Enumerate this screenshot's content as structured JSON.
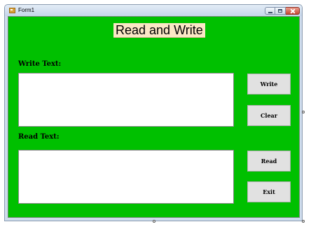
{
  "window": {
    "title": "Form1"
  },
  "form": {
    "heading": "Read and Write",
    "write_label": "Write Text:",
    "read_label": "Read Text:",
    "write_text_value": "",
    "read_text_value": ""
  },
  "buttons": {
    "write": "Write",
    "clear": "Clear",
    "read": "Read",
    "exit": "Exit"
  },
  "colors": {
    "form_background": "#00c000",
    "heading_background": "#fbe7c6",
    "button_background": "#e1e1e1",
    "textbox_background": "#ffffff"
  },
  "icons": {
    "app": "form-app-icon",
    "minimize": "minimize-icon",
    "maximize": "maximize-icon",
    "close": "close-icon"
  }
}
